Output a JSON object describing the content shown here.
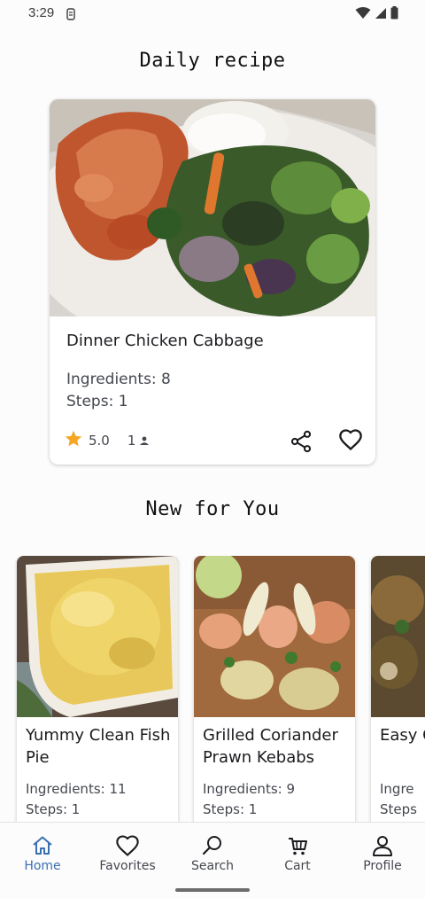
{
  "status_bar": {
    "time": "3:29"
  },
  "daily": {
    "title": "Daily recipe",
    "recipe": {
      "name": "Dinner Chicken Cabbage",
      "ingredients": "Ingredients: 8",
      "steps": "Steps: 1",
      "rating": "5.0",
      "people": "1"
    }
  },
  "new_for_you": {
    "title": "New for You",
    "items": [
      {
        "name": "Yummy Clean Fish Pie",
        "ingredients": "Ingredients: 11",
        "steps": "Steps: 1"
      },
      {
        "name": "Grilled Coriander Prawn Kebabs",
        "ingredients": "Ingredients: 9",
        "steps": "Steps: 1"
      },
      {
        "name": "Easy Chick",
        "ingredients": "Ingre",
        "steps": "Steps"
      }
    ]
  },
  "nav": {
    "items": [
      {
        "label": "Home",
        "icon": "home-icon"
      },
      {
        "label": "Favorites",
        "icon": "heart-icon"
      },
      {
        "label": "Search",
        "icon": "search-icon"
      },
      {
        "label": "Cart",
        "icon": "cart-icon"
      },
      {
        "label": "Profile",
        "icon": "person-icon"
      }
    ],
    "active": "Home"
  },
  "colors": {
    "accent": "#3a6fb0",
    "star": "#f5a623",
    "text": "#1c1b1f",
    "subtext": "#44474f"
  }
}
